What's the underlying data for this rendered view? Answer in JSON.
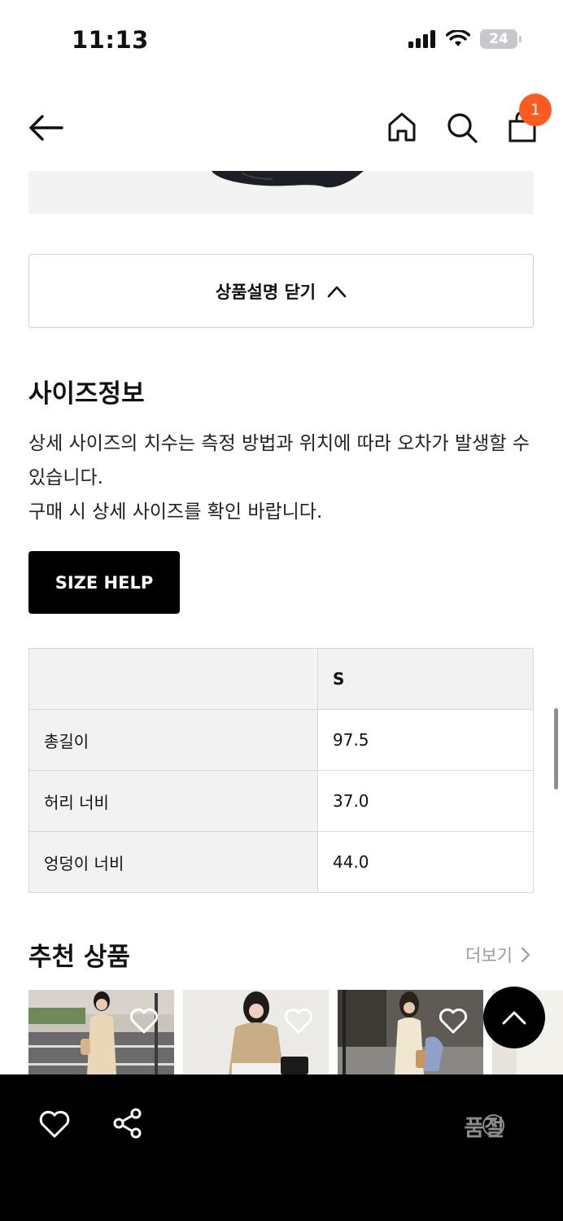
{
  "status_bar": {
    "time": "11:13",
    "battery": "24"
  },
  "nav": {
    "cart_count": "1"
  },
  "description_toggle": {
    "label": "상품설명 닫기"
  },
  "size_info": {
    "title": "사이즈정보",
    "description_line1": "상세 사이즈의 치수는 측정 방법과 위치에 따라 오차가 발생할 수 있습니다.",
    "description_line2": "구매 시 상세 사이즈를 확인 바랍니다.",
    "help_button": "SIZE HELP",
    "table": {
      "header": [
        "",
        "S"
      ],
      "rows": [
        [
          "총길이",
          "97.5"
        ],
        [
          "허리 너비",
          "37.0"
        ],
        [
          "엉덩이 너비",
          "44.0"
        ]
      ]
    }
  },
  "recommended": {
    "title": "추천 상품",
    "more_label": "더보기",
    "items": [
      {
        "icon": "heart-outline-icon"
      },
      {
        "icon": "heart-outline-icon"
      },
      {
        "icon": "heart-outline-icon"
      },
      {
        "icon": "heart-outline-icon"
      }
    ]
  },
  "bottom_bar": {
    "status_label": "품절",
    "help_icon_text": "?"
  },
  "colors": {
    "badge": "#ff5a1f",
    "bar": "#000000",
    "soldout": "#8b8b8b"
  }
}
